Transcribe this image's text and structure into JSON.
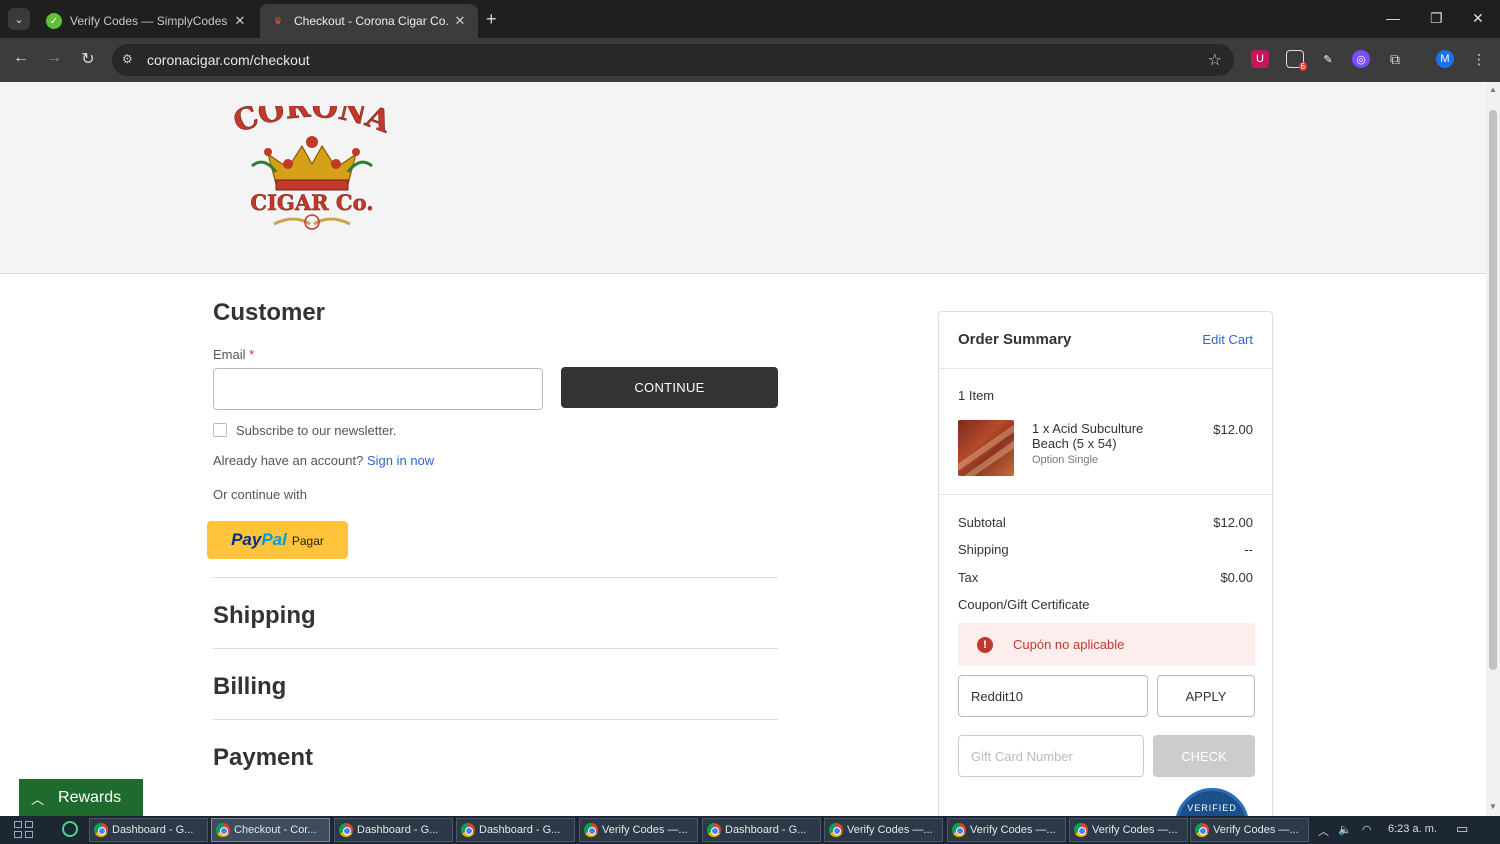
{
  "browser": {
    "tabs": [
      {
        "title": "Verify Codes — SimplyCodes",
        "active": false
      },
      {
        "title": "Checkout - Corona Cigar Co.",
        "active": true
      }
    ],
    "url": "coronacigar.com/checkout",
    "profile_initial": "M",
    "extension_badge": "6"
  },
  "header": {
    "logo_top": "CORONA",
    "logo_bottom": "CIGAR Co."
  },
  "customer": {
    "title": "Customer",
    "email_label": "Email",
    "required_mark": "*",
    "continue_label": "CONTINUE",
    "newsletter_label": "Subscribe to our newsletter.",
    "account_prompt": "Already have an account?",
    "sign_in_label": "Sign in now",
    "continue_with": "Or continue with",
    "paypal_word1": "Pay",
    "paypal_word2": "Pal",
    "paypal_action": "Pagar"
  },
  "sections": {
    "shipping": "Shipping",
    "billing": "Billing",
    "payment": "Payment"
  },
  "summary": {
    "title": "Order Summary",
    "edit_cart": "Edit Cart",
    "item_count": "1 Item",
    "item_name_line1": "1 x Acid Subculture",
    "item_name_line2": "Beach (5 x 54)",
    "item_option": "Option Single",
    "item_price": "$12.00",
    "subtotal_label": "Subtotal",
    "subtotal_value": "$12.00",
    "shipping_label": "Shipping",
    "shipping_value": "--",
    "tax_label": "Tax",
    "tax_value": "$0.00",
    "coupon_link": "Coupon/Gift Certificate",
    "error_message": "Cupón no aplicable",
    "coupon_value": "Reddit10",
    "apply_label": "APPLY",
    "gift_placeholder": "Gift Card Number",
    "check_label": "CHECK",
    "seal_text": "VERIFIED"
  },
  "rewards_label": "Rewards",
  "taskbar": {
    "apps": [
      {
        "label": "Dashboard - G...",
        "active": false
      },
      {
        "label": "Checkout - Cor...",
        "active": true
      },
      {
        "label": "Dashboard - G...",
        "active": false
      },
      {
        "label": "Dashboard - G...",
        "active": false
      },
      {
        "label": "Verify Codes —...",
        "active": false
      },
      {
        "label": "Dashboard - G...",
        "active": false
      },
      {
        "label": "Verify Codes —...",
        "active": false
      },
      {
        "label": "Verify Codes —...",
        "active": false
      },
      {
        "label": "Verify Codes —...",
        "active": false
      },
      {
        "label": "Verify Codes —...",
        "active": false
      }
    ],
    "time": "6:23 a. m."
  },
  "colors": {
    "accent_link": "#3366cc",
    "error": "#c0392b",
    "paypal_yellow": "#ffc439",
    "rewards_green": "#1e6b2d"
  }
}
